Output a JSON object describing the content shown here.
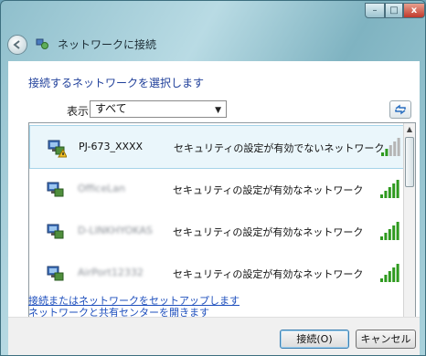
{
  "window": {
    "title": "ネットワークに接続",
    "controls": {
      "minimize": "–",
      "maximize": "□",
      "close": "x"
    }
  },
  "instruction": "接続するネットワークを選択します",
  "filter": {
    "label": "表示",
    "selected": "すべて"
  },
  "networks": [
    {
      "name": "PJ-673_XXXX",
      "security": "セキュリティの設定が有効でないネットワーク",
      "icon": "network-warning-icon",
      "signal": 2,
      "name_obscured": false
    },
    {
      "name": "OfficeLan",
      "security": "セキュリティの設定が有効なネットワーク",
      "icon": "network-icon",
      "signal": 5,
      "name_obscured": true
    },
    {
      "name": "D-LINKHYOKAS",
      "security": "セキュリティの設定が有効なネットワーク",
      "icon": "network-icon",
      "signal": 5,
      "name_obscured": true
    },
    {
      "name": "AirPort12332",
      "security": "セキュリティの設定が有効なネットワーク",
      "icon": "network-icon",
      "signal": 5,
      "name_obscured": true
    }
  ],
  "links": {
    "setup": "接続またはネットワークをセットアップします",
    "sharing_center": "ネットワークと共有センターを開きます"
  },
  "buttons": {
    "connect": "接続(O)",
    "cancel": "キャンセル"
  },
  "colors": {
    "link": "#1e4fbd",
    "signal_on": "#2e9a1e",
    "signal_off": "#b5b5b5",
    "selection": "#eaf6fb"
  }
}
